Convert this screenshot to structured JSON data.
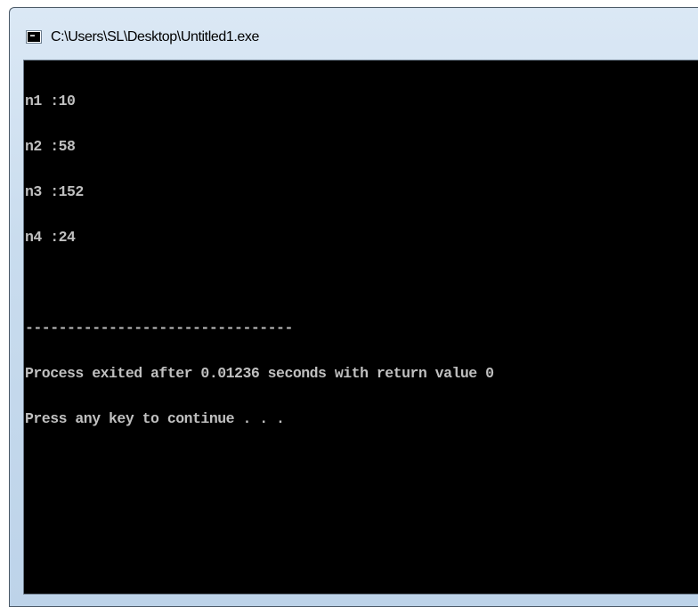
{
  "window": {
    "title": "C:\\Users\\SL\\Desktop\\Untitled1.exe",
    "icon": "console-window-icon"
  },
  "console": {
    "lines": [
      "n1 :10",
      "n2 :58",
      "n3 :152",
      "n4 :24",
      "",
      "--------------------------------",
      "Process exited after 0.01236 seconds with return value 0",
      "Press any key to continue . . ."
    ],
    "text_color": "#c0c0c0",
    "background_color": "#000000"
  }
}
